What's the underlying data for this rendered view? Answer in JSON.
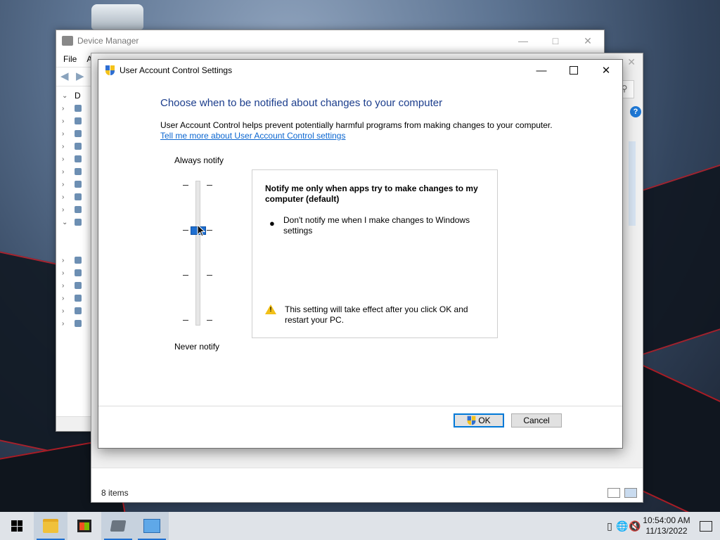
{
  "desktop": {
    "recycle_bin_label": ""
  },
  "device_manager": {
    "title": "Device Manager",
    "menu": [
      "File",
      "A"
    ],
    "tree_root": "D"
  },
  "control_panel": {
    "status_items": "8 items",
    "help_icon": "?"
  },
  "uac": {
    "title": "User Account Control Settings",
    "heading": "Choose when to be notified about changes to your computer",
    "description": "User Account Control helps prevent potentially harmful programs from making changes to your computer.",
    "link": "Tell me more about User Account Control settings",
    "label_top": "Always notify",
    "label_bottom": "Never notify",
    "slider_level": 2,
    "slider_levels_total": 4,
    "info_heading": "Notify me only when apps try to make changes to my computer (default)",
    "info_bullet": "Don't notify me when I make changes to Windows settings",
    "info_warning": "This setting will take effect after you click OK and restart your PC.",
    "ok_label": "OK",
    "cancel_label": "Cancel"
  },
  "taskbar": {
    "time": "10:54:00 AM",
    "date": "11/13/2022",
    "apps": [
      "start-icon",
      "file-explorer-icon",
      "store-icon",
      "device-manager-icon",
      "control-panel-icon"
    ]
  },
  "colors": {
    "heading_blue": "#1b3d8c",
    "link_blue": "#0b66d0",
    "thumb_blue": "#1f6fd0",
    "warning_yellow": "#f2c018"
  }
}
